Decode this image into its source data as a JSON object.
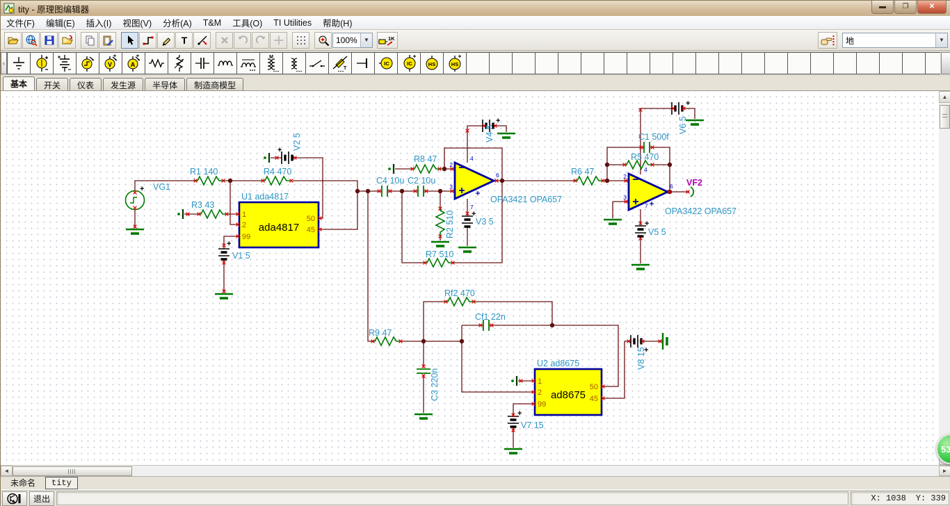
{
  "window": {
    "title": "tity - 原理图编辑器"
  },
  "menu": {
    "items": [
      "文件(F)",
      "编辑(E)",
      "插入(I)",
      "视图(V)",
      "分析(A)",
      "T&M",
      "工具(O)",
      "TI Utilities",
      "帮助(H)"
    ]
  },
  "toolbar": {
    "zoom_level": "100%",
    "find_value": "地",
    "icons": [
      "open",
      "web-open",
      "save",
      "import",
      "copy",
      "paste",
      "select",
      "wire",
      "pen",
      "text",
      "trim",
      "delete",
      "undo",
      "redo",
      "origin",
      "grid",
      "zoom",
      "show-values",
      "jump-to"
    ]
  },
  "palette": {
    "tabs": [
      "基本",
      "开关",
      "仪表",
      "发生源",
      "半导体",
      "制造商模型"
    ],
    "icons": [
      "ground",
      "voltage-source",
      "battery",
      "generator",
      "voltmeter",
      "ammeter",
      "resistor",
      "potentiometer",
      "capacitor",
      "inductor",
      "inductor-core",
      "coupled-inductors",
      "transformer",
      "switch",
      "controlled-switch",
      "jumper",
      "ic",
      "ic-power",
      "macro",
      "macro-power"
    ]
  },
  "schematic": {
    "labels": {
      "vg1": "VG1",
      "r1": "R1 140",
      "r3": "R3 43",
      "r4": "R4 470",
      "u1_ref": "U1 ada4817",
      "u1_part": "ada4817",
      "v1": "V1 5",
      "v2": "V2 5",
      "c4": "C4 10u",
      "c2": "C2 10u",
      "r8": "R8 47",
      "v4": "V4 5",
      "r2": "R2 510",
      "v3": "V3 5",
      "r7": "R7 510",
      "opamp1": "OPA3421 OPA657",
      "r6": "R6 47",
      "r5": "R5 470",
      "c1": "C1 500f",
      "v6": "V6 5",
      "v5": "V5 5",
      "opamp2": "OPA3422 OPA657",
      "vf2": "VF2",
      "rf2": "Rf2 470",
      "cf1": "Cf1 22n",
      "r9": "R9 47",
      "c3": "C3 220n",
      "u2_ref": "U2 ad8675",
      "u2_part": "ad8675",
      "v7": "V7 15",
      "v8": "V8 15"
    },
    "u1_pins": [
      "1",
      "2",
      "99",
      "50",
      "45"
    ],
    "u2_pins": [
      "1",
      "2",
      "99",
      "50",
      "45"
    ],
    "op_pins": [
      "2",
      "3",
      "4",
      "7",
      "6"
    ],
    "colors": {
      "wire": "#6b1414",
      "component": "#007a00",
      "label": "#2d95c5",
      "pin_text": "#a55a00",
      "output_label": "#b000b0",
      "ic_fill": "#ffff00",
      "ic_border": "#0000a0"
    }
  },
  "sheet_tabs": [
    "未命名",
    "tity"
  ],
  "status": {
    "exit": "退出",
    "x": "X: 1038",
    "y": "Y: 339"
  },
  "overlay": {
    "badge": "53"
  }
}
